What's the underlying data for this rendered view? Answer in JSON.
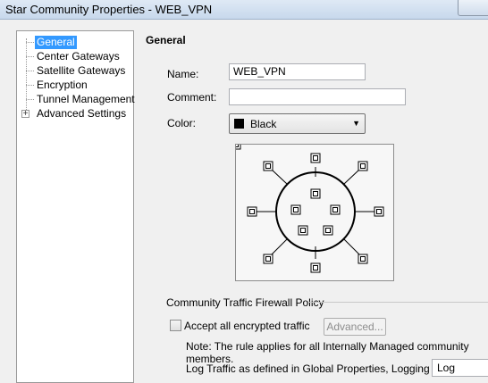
{
  "window": {
    "title": "Star Community Properties - WEB_VPN"
  },
  "tree": {
    "items": [
      {
        "label": "General",
        "selected": true
      },
      {
        "label": "Center Gateways"
      },
      {
        "label": "Satellite Gateways"
      },
      {
        "label": "Encryption"
      },
      {
        "label": "Tunnel Management"
      },
      {
        "label": "Advanced Settings",
        "expandable": true
      }
    ]
  },
  "general": {
    "heading": "General",
    "name_label": "Name:",
    "name_value": "WEB_VPN",
    "comment_label": "Comment:",
    "comment_value": "",
    "color_label": "Color:",
    "color_value": "Black",
    "color_swatch": "#000000"
  },
  "policy": {
    "heading": "Community Traffic Firewall Policy",
    "accept_label": "Accept all encrypted traffic",
    "accept_checked": false,
    "advanced_button": "Advanced...",
    "note": "Note: The rule applies for all Internally Managed community members.",
    "log_label": "Log Traffic as defined in Global Properties, Logging Tab:",
    "log_value": "Log"
  },
  "icons": {
    "gateway": "gateway-icon",
    "expand": "plus-expander-icon",
    "dropdown": "chevron-down-icon"
  }
}
